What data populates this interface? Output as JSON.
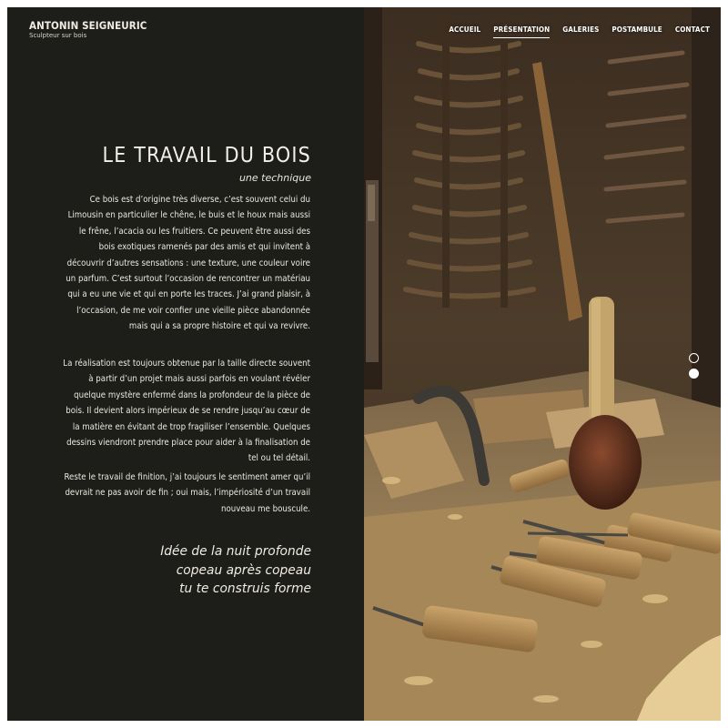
{
  "brand": {
    "name": "ANTONIN SEIGNEURIC",
    "tagline": "Sculpteur sur bois"
  },
  "nav": {
    "items": [
      {
        "label": "ACCUEIL",
        "active": false
      },
      {
        "label": "PRÉSENTATION",
        "active": true
      },
      {
        "label": "GALERIES",
        "active": false
      },
      {
        "label": "POSTAMBULE",
        "active": false
      },
      {
        "label": "CONTACT",
        "active": false
      }
    ]
  },
  "main": {
    "title": "LE TRAVAIL DU BOIS",
    "subtitle": "une technique",
    "paragraphs": [
      "Ce bois est d’origine très diverse, c’est souvent celui du Limousin en particulier le chêne, le buis et le houx mais aussi le frêne, l’acacia ou les fruitiers. Ce peuvent être aussi des bois exotiques ramenés par des amis et qui invitent à découvrir d’autres sensations : une texture, une couleur voire un parfum. C’est surtout l’occasion de rencontrer un matériau qui a eu une vie et qui en porte les traces. J’ai grand plaisir, à l’occasion, de me voir confier une vieille pièce abandonnée mais qui a sa propre histoire et qui va revivre.",
      "La réalisation est toujours obtenue par la taille directe souvent à partir d’un projet mais aussi parfois en voulant révéler quelque mystère enfermé dans la profondeur de la pièce de bois. Il devient alors impérieux de se rendre jusqu’au cœur de la matière en évitant de trop fragiliser l’ensemble. Quelques dessins viendront prendre place pour aider à la finalisation de tel ou tel détail.",
      "Reste le travail de finition, j’ai toujours le sentiment amer qu’il devrait ne pas avoir de fin ; oui mais, l’impériosité d’un travail nouveau me bouscule."
    ],
    "poem": [
      "Idée de la nuit profonde",
      "copeau après copeau",
      "tu te construis forme"
    ]
  },
  "slider": {
    "count": 2,
    "active_index": 1
  },
  "colors": {
    "panel_bg": "#1d1e19",
    "text": "#ece8e0",
    "accent": "#ffffff"
  }
}
